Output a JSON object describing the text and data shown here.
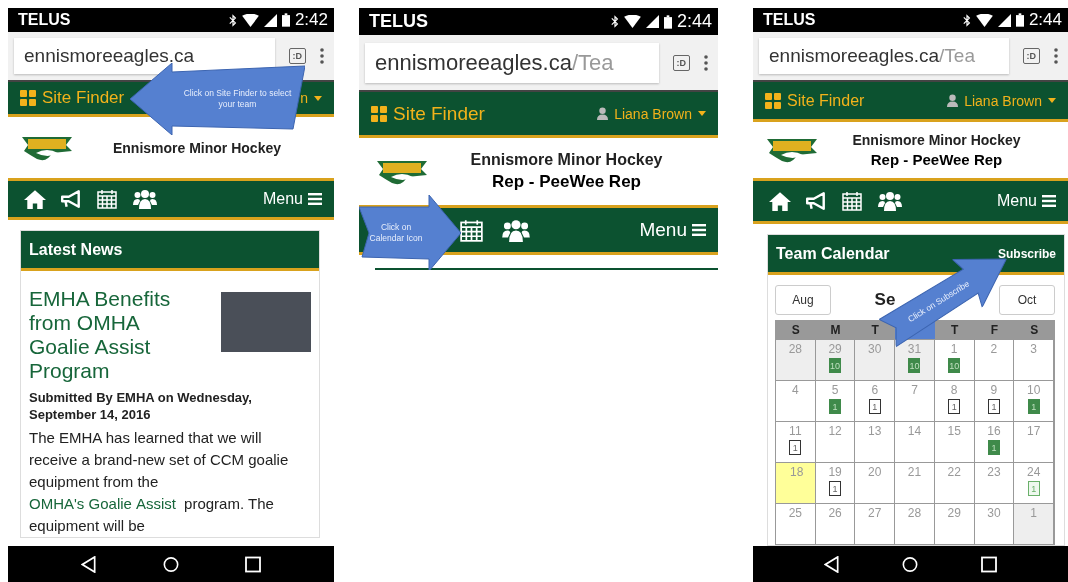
{
  "phones": [
    {
      "status": {
        "carrier": "TELUS",
        "time": "2:42"
      },
      "address": {
        "host": "ennismoreeagles.ca",
        "tab_count": ":D"
      },
      "topbar": {
        "site_finder": "Site Finder",
        "user_icon": false,
        "user_name": "n"
      },
      "header": {
        "title": "Ennismore Minor Hockey"
      },
      "nav": {
        "menu": "Menu"
      },
      "system_nav": true,
      "content": {
        "kind": "news",
        "card_title": "Latest News",
        "headline": "EMHA Benefits from OMHA Goalie Assist Program",
        "byline": "Submitted By EMHA on Wednesday, September 14, 2016",
        "body": [
          {
            "text": "The EMHA has learned that we will receive a brand-new set of CCM goalie equipment from the ",
            "link": false
          },
          {
            "text": "OMHA's Goalie",
            "link": true
          },
          {
            "text": "Assist",
            "link": true
          },
          {
            "text": " program. The equipment will be",
            "link": false
          }
        ]
      },
      "callout": {
        "kind": "left",
        "text": "Click on Site Finder to select your team"
      }
    },
    {
      "status": {
        "carrier": "TELUS",
        "time": "2:44"
      },
      "address": {
        "host": "ennismoreeagles.ca",
        "path": "/Tea",
        "tab_count": ":D"
      },
      "topbar": {
        "site_finder": "Site Finder",
        "user_icon": true,
        "user_name": "Liana Brown"
      },
      "header": {
        "title": "Ennismore Minor Hockey",
        "subtitle": "Rep - PeeWee Rep"
      },
      "nav": {
        "menu": "Menu"
      },
      "system_nav": false,
      "content": {
        "kind": "card_edge"
      },
      "callout": {
        "kind": "right",
        "text": "Click on Calendar Icon"
      }
    },
    {
      "status": {
        "carrier": "TELUS",
        "time": "2:44"
      },
      "address": {
        "host": "ennismoreeagles.ca",
        "path": "/Tea",
        "tab_count": ":D"
      },
      "topbar": {
        "site_finder": "Site Finder",
        "user_icon": true,
        "user_name": "Liana Brown"
      },
      "header": {
        "title": "Ennismore Minor Hockey",
        "subtitle": "Rep - PeeWee Rep"
      },
      "nav": {
        "menu": "Menu"
      },
      "system_nav": true,
      "content": {
        "kind": "calendar",
        "card_title": "Team Calendar",
        "subscribe": "Subscribe",
        "prev": "Aug",
        "month": "Se",
        "next": "Oct",
        "weekdays": [
          {
            "label": "S",
            "covered": false
          },
          {
            "label": "M",
            "covered": false
          },
          {
            "label": "T",
            "covered": false
          },
          {
            "covered": true
          },
          {
            "label": "T",
            "covered": false
          },
          {
            "label": "F",
            "covered": false
          },
          {
            "label": "S",
            "covered": false
          }
        ],
        "weeks": [
          [
            {
              "day": "28",
              "outside": true,
              "today": false
            },
            {
              "day": "29",
              "outside": true,
              "today": false,
              "events": [
                {
                  "label": "10",
                  "kind": "solid"
                }
              ]
            },
            {
              "day": "30",
              "outside": true,
              "today": false
            },
            {
              "day": "31",
              "outside": true,
              "today": false,
              "events": [
                {
                  "label": "10",
                  "kind": "solid"
                }
              ]
            },
            {
              "day": "1",
              "outside": false,
              "today": false,
              "events": [
                {
                  "label": "10",
                  "kind": "solid"
                }
              ]
            },
            {
              "day": "2",
              "outside": false,
              "today": false
            },
            {
              "day": "3",
              "outside": false,
              "today": false
            }
          ],
          [
            {
              "day": "4",
              "outside": false,
              "today": false
            },
            {
              "day": "5",
              "outside": false,
              "today": false,
              "events": [
                {
                  "label": "1",
                  "kind": "solid"
                }
              ]
            },
            {
              "day": "6",
              "outside": false,
              "today": false,
              "events": [
                {
                  "label": "1",
                  "kind": "outline"
                }
              ]
            },
            {
              "day": "7",
              "outside": false,
              "today": false
            },
            {
              "day": "8",
              "outside": false,
              "today": false,
              "events": [
                {
                  "label": "1",
                  "kind": "outline"
                }
              ]
            },
            {
              "day": "9",
              "outside": false,
              "today": false,
              "events": [
                {
                  "label": "1",
                  "kind": "outline"
                }
              ]
            },
            {
              "day": "10",
              "outside": false,
              "today": false,
              "events": [
                {
                  "label": "1",
                  "kind": "solid"
                }
              ]
            }
          ],
          [
            {
              "day": "11",
              "outside": false,
              "today": false,
              "events": [
                {
                  "label": "1",
                  "kind": "outline"
                }
              ]
            },
            {
              "day": "12",
              "outside": false,
              "today": false
            },
            {
              "day": "13",
              "outside": false,
              "today": false
            },
            {
              "day": "14",
              "outside": false,
              "today": false
            },
            {
              "day": "15",
              "outside": false,
              "today": false
            },
            {
              "day": "16",
              "outside": false,
              "today": false,
              "events": [
                {
                  "label": "1",
                  "kind": "solid"
                }
              ]
            },
            {
              "day": "17",
              "outside": false,
              "today": false
            }
          ],
          [
            {
              "day": "18",
              "outside": false,
              "today": true
            },
            {
              "day": "19",
              "outside": false,
              "today": false,
              "events": [
                {
                  "label": "1",
                  "kind": "outline"
                }
              ]
            },
            {
              "day": "20",
              "outside": false,
              "today": false
            },
            {
              "day": "21",
              "outside": false,
              "today": false
            },
            {
              "day": "22",
              "outside": false,
              "today": false
            },
            {
              "day": "23",
              "outside": false,
              "today": false
            },
            {
              "day": "24",
              "outside": false,
              "today": false,
              "events": [
                {
                  "label": "1",
                  "kind": "light"
                }
              ]
            }
          ],
          [
            {
              "day": "25",
              "outside": false,
              "today": false
            },
            {
              "day": "26",
              "outside": false,
              "today": false
            },
            {
              "day": "27",
              "outside": false,
              "today": false
            },
            {
              "day": "28",
              "outside": false,
              "today": false
            },
            {
              "day": "29",
              "outside": false,
              "today": false
            },
            {
              "day": "30",
              "outside": false,
              "today": false
            },
            {
              "day": "1",
              "outside": true,
              "today": false
            }
          ]
        ]
      },
      "callout": {
        "kind": "up-right",
        "text": "Click on Subscribe"
      }
    }
  ]
}
